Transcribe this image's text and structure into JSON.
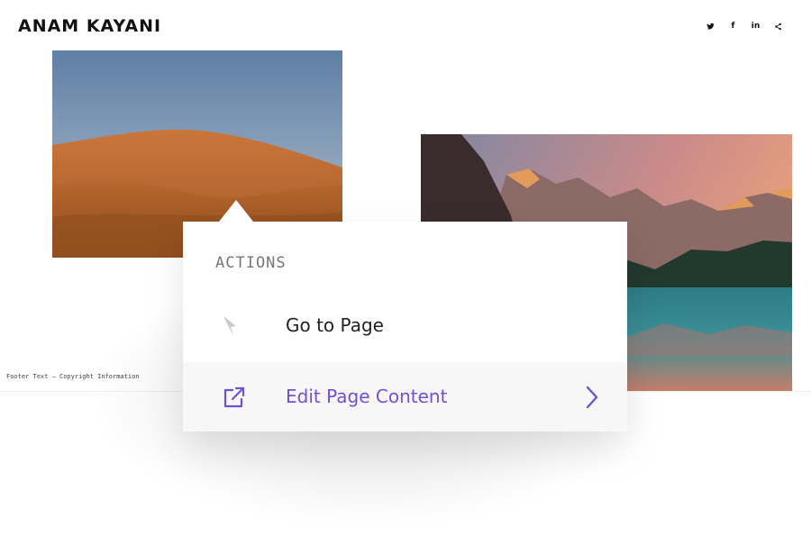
{
  "site": {
    "logo": "ANAM KAYANI"
  },
  "social": [
    {
      "icon": "twitter-icon"
    },
    {
      "icon": "facebook-icon",
      "label": "f"
    },
    {
      "icon": "linkedin-icon",
      "label": "in"
    },
    {
      "icon": "share-icon"
    }
  ],
  "footer": {
    "text": "Footer Text – Copyright Information"
  },
  "actions_menu": {
    "heading": "ACTIONS",
    "items": [
      {
        "label": "Go to Page",
        "icon": "cursor-arrow-icon"
      },
      {
        "label": "Edit Page Content",
        "icon": "external-link-icon",
        "trailing_icon": "chevron-right-icon"
      }
    ]
  },
  "colors": {
    "accent": "#6f51d8",
    "hover_row": "#f7f7f8"
  }
}
